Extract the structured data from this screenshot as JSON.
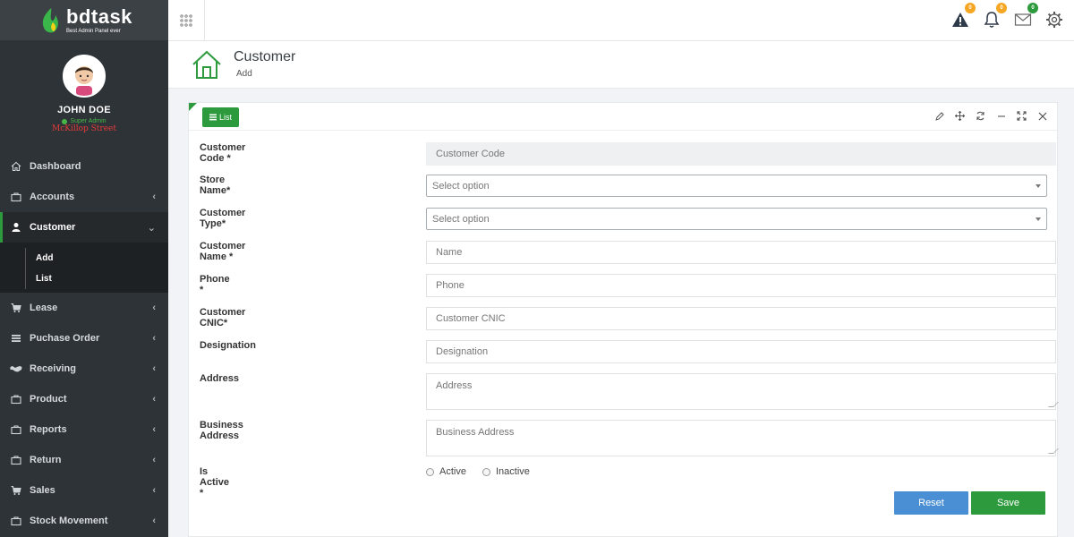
{
  "brand": {
    "name": "bdtask",
    "tagline": "Best Admin Panel ever"
  },
  "profile": {
    "name": "JOHN DOE",
    "role": "Super Admin",
    "location": "McKillop Street"
  },
  "sidebar": {
    "items": [
      {
        "label": "Dashboard",
        "icon": "home-icon"
      },
      {
        "label": "Accounts",
        "icon": "briefcase-icon"
      },
      {
        "label": "Customer",
        "icon": "user-icon"
      },
      {
        "label": "Lease",
        "icon": "cart-icon"
      },
      {
        "label": "Puchase Order",
        "icon": "list-icon"
      },
      {
        "label": "Receiving",
        "icon": "handshake-icon"
      },
      {
        "label": "Product",
        "icon": "briefcase-icon"
      },
      {
        "label": "Reports",
        "icon": "briefcase-icon"
      },
      {
        "label": "Return",
        "icon": "briefcase-icon"
      },
      {
        "label": "Sales",
        "icon": "cart-icon"
      },
      {
        "label": "Stock Movement",
        "icon": "briefcase-icon"
      }
    ],
    "submenu": [
      {
        "label": "Add"
      },
      {
        "label": "List"
      }
    ]
  },
  "topbar": {
    "badges": {
      "alerts": "0",
      "notifications": "0",
      "messages": "0"
    }
  },
  "header": {
    "title": "Customer",
    "subtitle": "Add"
  },
  "panel": {
    "list_button": "List"
  },
  "form": {
    "customer_code": {
      "label": "Customer Code *",
      "placeholder": "Customer Code"
    },
    "store_name": {
      "label": "Store Name*",
      "value": "Select option"
    },
    "customer_type": {
      "label": "Customer Type*",
      "value": "Select option"
    },
    "customer_name": {
      "label": "Customer Name *",
      "placeholder": "Name"
    },
    "phone": {
      "label": "Phone *",
      "placeholder": "Phone"
    },
    "cnic": {
      "label": "Customer CNIC*",
      "placeholder": "Customer CNIC"
    },
    "designation": {
      "label": "Designation",
      "placeholder": "Designation"
    },
    "address": {
      "label": "Address",
      "placeholder": "Address"
    },
    "business_address": {
      "label": "Business Address",
      "placeholder": "Business Address"
    },
    "is_active": {
      "label": "Is Active *",
      "options": [
        "Active",
        "Inactive"
      ]
    },
    "reset_label": "Reset",
    "save_label": "Save"
  },
  "colors": {
    "accent": "#2d9a3e",
    "sidebar_bg": "#2e3337",
    "reset": "#4a8fd4",
    "badge_warn": "#f5a623"
  }
}
